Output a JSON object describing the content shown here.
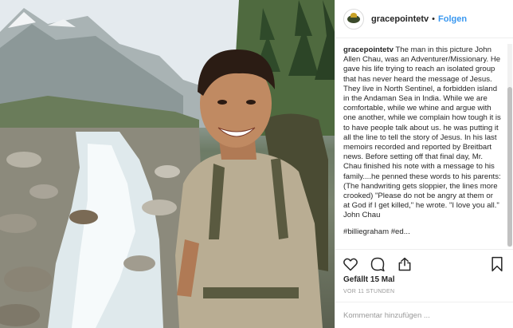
{
  "post": {
    "username": "gracepointetv",
    "separator": "•",
    "follow_label": "Folgen",
    "caption_user": "gracepointetv",
    "caption_text": " The man in this picture John Allen Chau, was an Adventurer/Missionary. He gave his life trying to reach an isolated group that has never heard the message of Jesus. They live in North Sentinel, a forbidden island in the Andaman Sea in India. While we are comfortable, while we whine and argue with one another, while we complain how tough it is to have people talk about us. he was putting it all the line to tell the story of Jesus. In his last memoirs recorded and reported by Breitbart news. Before setting off that final day, Mr. Chau finished his note with a message to his family....he penned these words to his parents: (The handwriting gets sloppier, the lines more crooked) \"Please do not be angry at them or at God if I get killed,\" he wrote. \"I love you all.\" John Chau",
    "caption_overflow": "#billiegraham #ed...",
    "likes": "Gefällt 15 Mal",
    "timestamp": "VOR 11 STUNDEN",
    "comment_placeholder": "Kommentar hinzufügen ..."
  },
  "icons": {
    "like": "heart-icon",
    "comment": "comment-icon",
    "share": "share-icon",
    "save": "bookmark-icon"
  }
}
